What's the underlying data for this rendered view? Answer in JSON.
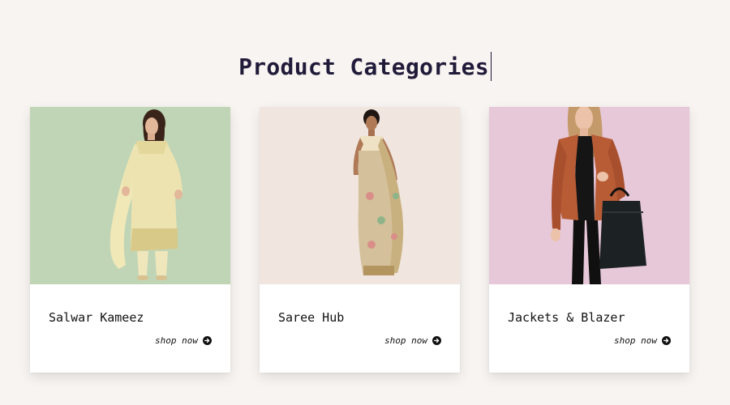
{
  "page": {
    "title": "Product Categories"
  },
  "categories": [
    {
      "name": "Salwar Kameez",
      "link_label": "shop now",
      "image_bg": "#c0d5b6",
      "image_icon": "salwar-kameez-model-image"
    },
    {
      "name": "Saree Hub",
      "link_label": "shop now",
      "image_bg": "#f0e6df",
      "image_icon": "saree-model-image"
    },
    {
      "name": "Jackets & Blazer",
      "link_label": "shop now",
      "image_bg": "#e6c8d9",
      "image_icon": "jacket-model-image"
    }
  ],
  "colors": {
    "page_bg": "#f8f4f1",
    "title": "#211b3a",
    "card_bg": "#ffffff",
    "text": "#111111"
  }
}
